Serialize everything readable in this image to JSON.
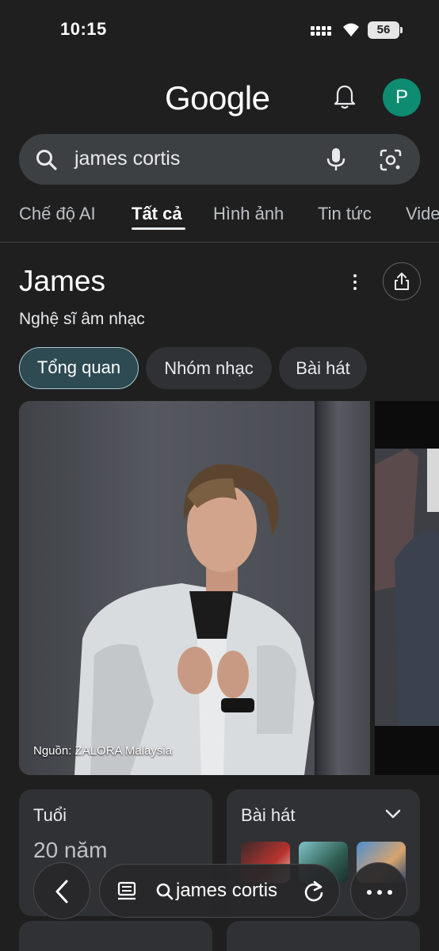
{
  "status_bar": {
    "time": "10:15",
    "battery": "56"
  },
  "header": {
    "logo": "Google",
    "avatar_letter": "P"
  },
  "search": {
    "query": "james cortis"
  },
  "tabs": [
    {
      "label": "Chế độ AI"
    },
    {
      "label": "Tất cả"
    },
    {
      "label": "Hình ảnh"
    },
    {
      "label": "Tin tức"
    },
    {
      "label": "Vide"
    }
  ],
  "panel": {
    "title": "James",
    "subtitle": "Nghệ sĩ âm nhạc",
    "chips": [
      {
        "label": "Tổng quan"
      },
      {
        "label": "Nhóm nhạc"
      },
      {
        "label": "Bài hát"
      }
    ],
    "image_caption": "Nguồn: ZALORA Malaysia"
  },
  "cards": {
    "age": {
      "label": "Tuổi",
      "value": "20 năm"
    },
    "songs": {
      "label": "Bài hát"
    }
  },
  "toolbar": {
    "url_text": "james cortis"
  },
  "icons": {
    "bell": "bell-icon",
    "search": "search-icon",
    "mic": "mic-icon",
    "lens": "lens-icon",
    "share": "share-icon",
    "more": "more-vert-icon",
    "back": "chevron-left-icon",
    "reader": "reader-icon",
    "reload": "reload-icon",
    "overflow": "more-horizontal-icon"
  },
  "colors": {
    "background": "#1f1f1f",
    "search_bg": "#3c4043",
    "avatar": "#0d8c72",
    "chip_active": "#2e4a52"
  }
}
